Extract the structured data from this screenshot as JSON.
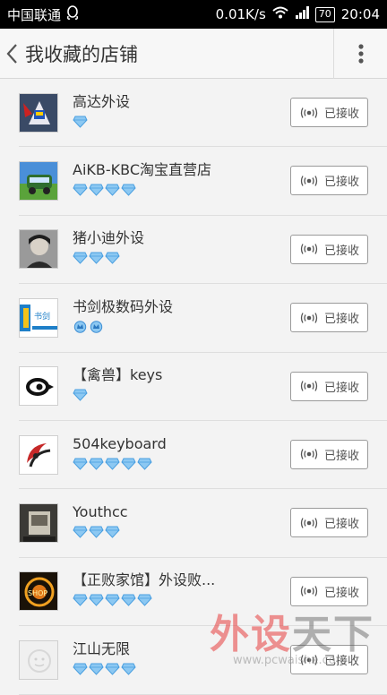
{
  "status_bar": {
    "carrier": "中国联通",
    "network_speed": "0.01K/s",
    "battery": "70",
    "time": "20:04"
  },
  "header": {
    "title": "我收藏的店铺"
  },
  "accent_colors": {
    "gem_blue": "#8cc8f2",
    "gem_dark": "#4a9fe0"
  },
  "stores": [
    {
      "name": "高达外设",
      "gems": 1,
      "gem_type": "diamond",
      "button_label": "已接收",
      "icon": "receive-signal-icon"
    },
    {
      "name": "AiKB-KBC淘宝直营店",
      "gems": 4,
      "gem_type": "diamond",
      "button_label": "已接收",
      "icon": "receive-signal-icon"
    },
    {
      "name": "猪小迪外设",
      "gems": 3,
      "gem_type": "diamond",
      "button_label": "已接收",
      "icon": "receive-signal-icon"
    },
    {
      "name": "书剑极数码外设",
      "gems": 2,
      "gem_type": "crown",
      "button_label": "已接收",
      "icon": "receive-signal-icon"
    },
    {
      "name": "【禽兽】keys",
      "gems": 1,
      "gem_type": "diamond",
      "button_label": "已接收",
      "icon": "receive-signal-icon"
    },
    {
      "name": "504keyboard",
      "gems": 5,
      "gem_type": "diamond",
      "button_label": "已接收",
      "icon": "receive-signal-icon"
    },
    {
      "name": "Youthcc",
      "gems": 3,
      "gem_type": "diamond",
      "button_label": "已接收",
      "icon": "receive-signal-icon"
    },
    {
      "name": "【正败家馆】外设败...",
      "gems": 5,
      "gem_type": "diamond",
      "button_label": "已接收",
      "icon": "receive-signal-icon"
    },
    {
      "name": "江山无限",
      "gems": 4,
      "gem_type": "diamond",
      "button_label": "已接收",
      "icon": "receive-signal-icon"
    }
  ],
  "watermark": {
    "text_red": "外设",
    "text_dark": "天下",
    "url": "www.pcwaishe.com"
  }
}
